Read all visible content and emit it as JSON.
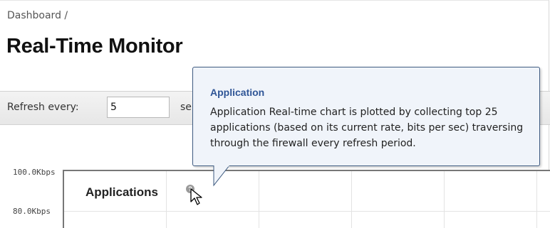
{
  "breadcrumb": "Dashboard /",
  "page_title": "Real-Time Monitor",
  "toolbar": {
    "refresh_label": "Refresh every:",
    "refresh_value": "5",
    "refresh_unit_partial": "se"
  },
  "chart": {
    "title": "Applications",
    "y_ticks": [
      "100.0Kbps",
      "80.0Kbps"
    ]
  },
  "tooltip": {
    "title": "Application",
    "body": "Application Real-time chart is plotted by collecting top 25 applications (based on its current rate, bits per sec) traversing through the firewall every refresh period."
  },
  "colors": {
    "tooltip_title": "#2f5596",
    "tooltip_border": "#3d5a80",
    "tooltip_bg": "#f0f4fa"
  },
  "icons": {
    "help": "help-icon",
    "cursor": "pointer-cursor-icon"
  }
}
